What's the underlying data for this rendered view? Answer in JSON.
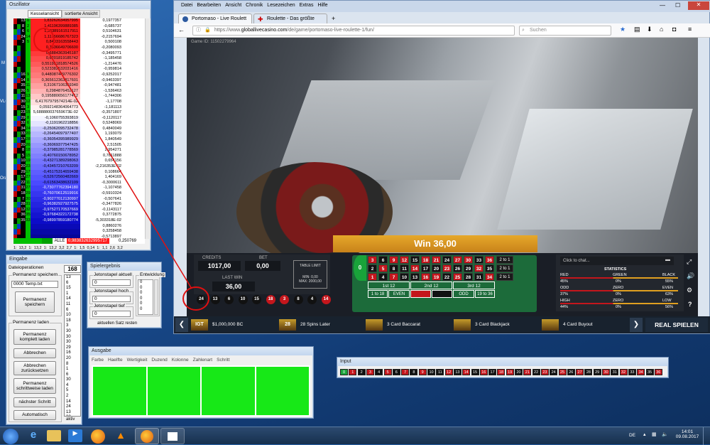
{
  "desktop_labels": [
    "M",
    "VLC",
    "Oracl"
  ],
  "oszillator": {
    "title": "Oszillator",
    "tabs": [
      "Kesselansicht",
      "sortierte Ansicht"
    ],
    "rows": [
      {
        "n": "13",
        "a": "0",
        "v1": "1,83262634957995",
        "v2": "0,1977357",
        "bg": "#ff2020",
        "nc": "#000"
      },
      {
        "n": "8",
        "a": "2",
        "v1": "1,41196399889385",
        "v2": "-0,685737",
        "bg": "#ff2020",
        "nc": "#000"
      },
      {
        "n": "6",
        "a": "6",
        "v1": "1,36389161517911",
        "v2": "0,5104631",
        "bg": "#ff2020",
        "nc": "#000"
      },
      {
        "n": "24",
        "a": "14",
        "v1": "1,11766686767323",
        "v2": "-0,2157694",
        "bg": "#ff2020",
        "nc": "#000"
      },
      {
        "n": "3",
        "a": "5",
        "v1": "0,8403163558443",
        "v2": "0,500108",
        "bg": "#ff2020",
        "nc": "#000"
      },
      {
        "n": "",
        "a": "",
        "v1": "0,7536649706600",
        "v2": "-0,2080093",
        "bg": "#ff2020",
        "nc": "#000"
      },
      {
        "n": "",
        "a": "",
        "v1": "0,6884363945187",
        "v2": "-0,3495771",
        "bg": "#ff3a3a",
        "nc": "#000"
      },
      {
        "n": "",
        "a": "",
        "v1": "0,6201819185742",
        "v2": "-1,185458",
        "bg": "#ff4b4b",
        "nc": "#000"
      },
      {
        "n": "",
        "a": "",
        "v1": "0,551951818574526",
        "v2": "-1,214476",
        "bg": "#ff5a5a",
        "nc": "#000"
      },
      {
        "n": "",
        "a": "",
        "v1": "0,523382532031416",
        "v2": "-0,959814",
        "bg": "#ff6e6e",
        "nc": "#000"
      },
      {
        "n": "16",
        "a": "9",
        "v1": "0,448087449776302",
        "v2": "-0,9252017",
        "bg": "#ff7a7a",
        "nc": "#000"
      },
      {
        "n": "14",
        "a": "8",
        "v1": "0,365612363817601",
        "v2": "-0,9463397",
        "bg": "#ff8d8d",
        "nc": "#000"
      },
      {
        "n": "35",
        "a": "11",
        "v1": "0,31067106369340",
        "v2": "-0,947481",
        "bg": "#ffa0a0",
        "nc": "#000"
      },
      {
        "n": "26",
        "a": "5",
        "v1": "0,2984876452127",
        "v2": "-1,536463",
        "bg": "#ffb3b3",
        "nc": "#000"
      },
      {
        "n": "11",
        "a": "13",
        "v1": "0,195880656177412",
        "v2": "-1,744306",
        "bg": "#ffc8c8",
        "nc": "#000"
      },
      {
        "n": "30",
        "a": "12",
        "v1": "6,41767979574214E-02",
        "v2": "-1,17708",
        "bg": "#ffdede",
        "nc": "#000"
      },
      {
        "n": "15",
        "a": "3",
        "v1": "0,0592148364064773",
        "v2": "-1,181113",
        "bg": "#fff0f0",
        "nc": "#000"
      },
      {
        "n": "23",
        "a": "15",
        "v1": "5,688880037659673E-02",
        "v2": "-0,3571807",
        "bg": "#ffffff",
        "nc": "#000"
      },
      {
        "n": "29",
        "a": "8",
        "v1": "-0,1060755393819",
        "v2": "-0,1120117",
        "bg": "#f4f4ff",
        "nc": "#000"
      },
      {
        "n": "32",
        "a": "6",
        "v1": "-0,1191962218856",
        "v2": "0,5248069",
        "bg": "#e4e4ff",
        "nc": "#000"
      },
      {
        "n": "34",
        "a": "24",
        "v1": "-0,25062095732478",
        "v2": "0,4840049",
        "bg": "#c8c8ff",
        "nc": "#000"
      },
      {
        "n": "33",
        "a": "20",
        "v1": "-0,26454097977407",
        "v2": "1,193079",
        "bg": "#b8b8ff",
        "nc": "#000"
      },
      {
        "n": "17",
        "a": "28",
        "v1": "-0,36054395989929",
        "v2": "1,840549",
        "bg": "#a8a8ff",
        "nc": "#000"
      },
      {
        "n": "20",
        "a": "26",
        "v1": "-0,36069377547425",
        "v2": "2,51505",
        "bg": "#9898ff",
        "nc": "#000"
      },
      {
        "n": "8",
        "a": "18",
        "v1": "-0,37985281778569",
        "v2": "2,954271",
        "bg": "#8c8cff",
        "nc": "#000"
      },
      {
        "n": "5",
        "a": "15",
        "v1": "-0,40760150678952",
        "v2": "0,7811888",
        "bg": "#8080ff",
        "nc": "#000"
      },
      {
        "n": "10",
        "a": "19",
        "v1": "-0,43271389298063",
        "v2": "0,654156",
        "bg": "#7474ff",
        "nc": "#000"
      },
      {
        "n": "20",
        "a": "23",
        "v1": "-0,43457210763209",
        "v2": "-2,216353E-02",
        "bg": "#6a6aff",
        "nc": "#000"
      },
      {
        "n": "29",
        "a": "17",
        "v1": "-0,45175314659438",
        "v2": "0,108664",
        "bg": "#5e5eff",
        "nc": "#000"
      },
      {
        "n": "17",
        "a": "27",
        "v1": "-0,52672560482669",
        "v2": "1,404169",
        "bg": "#5454ff",
        "nc": "#000"
      },
      {
        "n": "22",
        "a": "11",
        "v1": "-0,61563438632109",
        "v2": "-0,3000611",
        "bg": "#4a4aff",
        "nc": "#000"
      },
      {
        "n": "31",
        "a": "27",
        "v1": "-0,73077762394180",
        "v2": "-1,107458",
        "bg": "#4040f8",
        "nc": "#fff"
      },
      {
        "n": "18",
        "a": "29",
        "v1": "-0,76070612519916",
        "v2": "-0,5910324",
        "bg": "#3636f0",
        "nc": "#fff"
      },
      {
        "n": "7",
        "a": "30",
        "v1": "-0,90277012130997",
        "v2": "-0,507641",
        "bg": "#2c2ce8",
        "nc": "#fff"
      },
      {
        "n": "28",
        "a": "31",
        "v1": "-0,96382927927575",
        "v2": "-0,3477826",
        "bg": "#2424e0",
        "nc": "#fff"
      },
      {
        "n": "12",
        "a": "32",
        "v1": "-0,97527170537669",
        "v2": "-0,1143117",
        "bg": "#1c1cd8",
        "nc": "#fff"
      },
      {
        "n": "36",
        "a": "35",
        "v1": "-0,97684322172738",
        "v2": "0,3772875",
        "bg": "#1414d0",
        "nc": "#fff"
      },
      {
        "n": "35",
        "a": "33",
        "v1": "-0,98997859180774",
        "v2": "-5,303318E-02",
        "bg": "#0c0cc8",
        "nc": "#fff"
      },
      {
        "n": "",
        "a": "",
        "v1": "",
        "v2": "0,8860276",
        "bg": "#0a0ab8",
        "nc": "#fff"
      },
      {
        "n": "",
        "a": "",
        "v1": "",
        "v2": "0,3258458",
        "bg": "#0808a8",
        "nc": "#fff"
      },
      {
        "n": "",
        "a": "",
        "v1": "",
        "v2": "-0,5713897",
        "bg": "#060698",
        "nc": "#fff"
      },
      {
        "n": "",
        "a": "",
        "v1": "",
        "v2": "-0,1356029",
        "bg": "#050588",
        "nc": "#fff"
      },
      {
        "n": "",
        "a": "",
        "v1": "",
        "v2": "-0,4796715",
        "bg": "#040478",
        "nc": "#fff"
      },
      {
        "n": "",
        "a": "",
        "v1": "",
        "v2": "-0,4064593",
        "bg": "#030368",
        "nc": "#fff"
      },
      {
        "n": "",
        "a": "",
        "v1": "",
        "v2": "-0,3562071",
        "bg": "#020258",
        "nc": "#fff"
      }
    ],
    "alle_label": "ALLE",
    "alle_value": "0,983832632995717",
    "alle_right": "0,250769",
    "footer": [
      "1:",
      "13,2",
      "1:",
      "13,2",
      "1:",
      "13,2",
      "3,2",
      "2,7",
      "1:",
      "1,5",
      "0,14",
      "1:",
      "1,1",
      "2,6",
      "3,2"
    ]
  },
  "eingabe": {
    "title": "Eingabe",
    "dateioperationen": "Dateioperationen",
    "perm_speichern": "Permanenz speichern",
    "file_value": "0000 Temp.txt",
    "btn_perm_speichern": "Permanenz\nspeichern",
    "perm_laden": "Permanenz laden",
    "btn_komplett": "Permanenz\nkomplett laden",
    "btn_abbrechen": "Abbrechen",
    "btn_abbrechen_zurueck": "Abbrechen\nzurücksetzen",
    "btn_schrittweise": "Permanenz\nschrittweise laden",
    "btn_naechster": "nächster Schritt",
    "btn_automatisch": "Automatisch",
    "counter": "168",
    "numbers": [
      "13",
      "6",
      "15",
      "1",
      "14",
      "11",
      "6",
      "10",
      "18",
      "3",
      "30",
      "30",
      "30",
      "29",
      "16",
      "20",
      "8",
      "1",
      "6",
      "30",
      "4",
      "5",
      "2",
      "14",
      "24",
      "13",
      "32"
    ],
    "aktiv": "aktiv"
  },
  "spielergebnis": {
    "title": "Spielergebnis",
    "jeton_aktuell": "Jetonstapel aktuell",
    "jeton_aktuell_val": "0",
    "jeton_hoch": "Jetonstapel hoch",
    "jeton_hoch_val": "0",
    "jeton_tief": "Jetonstapel tief",
    "jeton_tief_val": "0",
    "entwicklung": "Entwicklung",
    "entwicklung_vals": [
      "0",
      "0",
      "0",
      "0",
      "0",
      "0"
    ],
    "btn_reset": "aktuellen Satz resten"
  },
  "ausgabe": {
    "title": "Ausgabe",
    "columns": [
      "Farbe",
      "Haelfte",
      "Wertigkeit",
      "Duzend",
      "Kolonne",
      "Zahlenart",
      "Schritt"
    ]
  },
  "input_panel": {
    "title": "Input",
    "cells": [
      {
        "v": "0",
        "c": "g"
      },
      {
        "v": "1",
        "c": "r"
      },
      {
        "v": "2",
        "c": "b"
      },
      {
        "v": "3",
        "c": "r"
      },
      {
        "v": "4",
        "c": "b"
      },
      {
        "v": "5",
        "c": "r"
      },
      {
        "v": "6",
        "c": "b"
      },
      {
        "v": "7",
        "c": "r"
      },
      {
        "v": "8",
        "c": "b"
      },
      {
        "v": "9",
        "c": "r"
      },
      {
        "v": "10",
        "c": "b"
      },
      {
        "v": "11",
        "c": "b"
      },
      {
        "v": "12",
        "c": "r"
      },
      {
        "v": "13",
        "c": "b"
      },
      {
        "v": "14",
        "c": "r"
      },
      {
        "v": "15",
        "c": "b"
      },
      {
        "v": "16",
        "c": "r"
      },
      {
        "v": "17",
        "c": "b"
      },
      {
        "v": "18",
        "c": "r"
      },
      {
        "v": "19",
        "c": "r"
      },
      {
        "v": "20",
        "c": "b"
      },
      {
        "v": "21",
        "c": "r"
      },
      {
        "v": "22",
        "c": "b"
      },
      {
        "v": "23",
        "c": "r"
      },
      {
        "v": "24",
        "c": "b"
      },
      {
        "v": "25",
        "c": "r"
      },
      {
        "v": "26",
        "c": "b"
      },
      {
        "v": "27",
        "c": "r"
      },
      {
        "v": "28",
        "c": "b"
      },
      {
        "v": "29",
        "c": "b"
      },
      {
        "v": "30",
        "c": "r"
      },
      {
        "v": "31",
        "c": "b"
      },
      {
        "v": "32",
        "c": "r"
      },
      {
        "v": "33",
        "c": "b"
      },
      {
        "v": "34",
        "c": "r"
      },
      {
        "v": "35",
        "c": "b"
      },
      {
        "v": "36",
        "c": "r"
      }
    ]
  },
  "browser": {
    "menu": [
      "Datei",
      "Bearbeiten",
      "Ansicht",
      "Chronik",
      "Lesezeichen",
      "Extras",
      "Hilfe"
    ],
    "tab1": "Portomaso - Live Roulett",
    "tab2": "Roulette - Das größte deutsc",
    "url_host": "https://www.",
    "url_domain": "globallivecasino.com",
    "url_path": "/de/game/portomaso-live-roulette-1/fun/",
    "search_placeholder": "Suchen",
    "game_id": "Game ID: 11502279964"
  },
  "game": {
    "win": "Win 36,00",
    "credits_label": "CREDITS",
    "credits": "1017,00",
    "bet_label": "BET",
    "bet": "0,00",
    "last_win_label": "LAST WIN",
    "last_win": "36,00",
    "table_limit": "TABLE LIMIT",
    "min": "MIN: 0,00",
    "max": "MAX: 2000,00",
    "history": [
      {
        "v": "24",
        "c": "b"
      },
      {
        "v": "13",
        "c": "b"
      },
      {
        "v": "6",
        "c": "b"
      },
      {
        "v": "10",
        "c": "b"
      },
      {
        "v": "15",
        "c": "b"
      },
      {
        "v": "18",
        "c": "r"
      },
      {
        "v": "3",
        "c": "r"
      },
      {
        "v": "8",
        "c": "b"
      },
      {
        "v": "4",
        "c": "b"
      },
      {
        "v": "14",
        "c": "r"
      }
    ],
    "grid_top": [
      {
        "v": "3",
        "c": "r"
      },
      {
        "v": "6",
        "c": "b"
      },
      {
        "v": "9",
        "c": "r"
      },
      {
        "v": "12",
        "c": "r"
      },
      {
        "v": "15",
        "c": "b"
      },
      {
        "v": "18",
        "c": "r"
      },
      {
        "v": "21",
        "c": "r"
      },
      {
        "v": "24",
        "c": "b"
      },
      {
        "v": "27",
        "c": "r"
      },
      {
        "v": "30",
        "c": "r"
      },
      {
        "v": "33",
        "c": "b"
      },
      {
        "v": "36",
        "c": "r"
      }
    ],
    "grid_mid": [
      {
        "v": "2",
        "c": "b"
      },
      {
        "v": "5",
        "c": "r"
      },
      {
        "v": "8",
        "c": "b"
      },
      {
        "v": "11",
        "c": "b"
      },
      {
        "v": "14",
        "c": "r"
      },
      {
        "v": "17",
        "c": "b"
      },
      {
        "v": "20",
        "c": "b"
      },
      {
        "v": "23",
        "c": "r"
      },
      {
        "v": "26",
        "c": "b"
      },
      {
        "v": "29",
        "c": "b"
      },
      {
        "v": "32",
        "c": "r"
      },
      {
        "v": "35",
        "c": "b"
      }
    ],
    "grid_bot": [
      {
        "v": "1",
        "c": "r"
      },
      {
        "v": "4",
        "c": "b"
      },
      {
        "v": "7",
        "c": "r"
      },
      {
        "v": "10",
        "c": "b"
      },
      {
        "v": "13",
        "c": "b"
      },
      {
        "v": "16",
        "c": "r"
      },
      {
        "v": "19",
        "c": "r"
      },
      {
        "v": "22",
        "c": "b"
      },
      {
        "v": "25",
        "c": "r"
      },
      {
        "v": "28",
        "c": "b"
      },
      {
        "v": "31",
        "c": "b"
      },
      {
        "v": "34",
        "c": "r"
      }
    ],
    "two_to_one": "2 to 1",
    "dozen1": "1st 12",
    "dozen2": "2nd 12",
    "dozen3": "3rd 12",
    "low": "1 to 18",
    "even": "EVEN",
    "odd": "ODD",
    "high": "19 to 36",
    "chat": "Click to chat...",
    "stats_title": "STATISTICS",
    "stats": [
      {
        "l": "RED",
        "m": "GREEN",
        "r": "BLACK",
        "lv": "45%",
        "mv": "0%",
        "rv": "55%"
      },
      {
        "l": "ODD",
        "m": "ZERO",
        "r": "EVEN",
        "lv": "37%",
        "mv": "0%",
        "rv": "63%"
      },
      {
        "l": "HIGH",
        "m": "ZERO",
        "r": "LOW",
        "lv": "44%",
        "mv": "0%",
        "rv": "56%"
      }
    ],
    "ticker": [
      {
        "img": "IGT",
        "text": "$1,000,000 BC"
      },
      {
        "img": "28",
        "text": "28 Spins Later"
      },
      {
        "img": "",
        "text": "3 Card Baccarat"
      },
      {
        "img": "",
        "text": "3 Card Blackjack"
      },
      {
        "img": "",
        "text": "4 Card Buyout"
      }
    ],
    "real_play": "REAL SPIELEN"
  },
  "taskbar": {
    "lang": "DE",
    "time": "14:01",
    "date": "09.08.2017"
  }
}
